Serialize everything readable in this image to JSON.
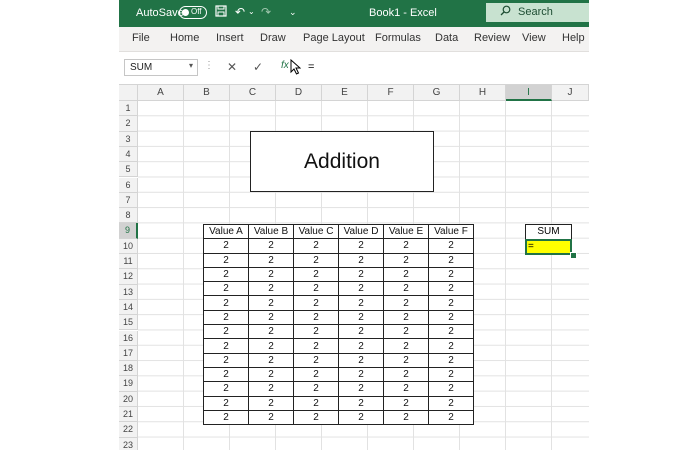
{
  "titlebar": {
    "autosave_label": "AutoSave",
    "autosave_state": "Off",
    "doc_title": "Book1  -  Excel",
    "search_placeholder": "Search",
    "accent": "#217346"
  },
  "menu": [
    "File",
    "Home",
    "Insert",
    "Draw",
    "Page Layout",
    "Formulas",
    "Data",
    "Review",
    "View",
    "Help"
  ],
  "formula_bar": {
    "name_box": "SUM",
    "formula": "="
  },
  "columns": [
    "A",
    "B",
    "C",
    "D",
    "E",
    "F",
    "G",
    "H",
    "I",
    "J"
  ],
  "selected_column": "I",
  "rows": [
    "1",
    "2",
    "3",
    "4",
    "5",
    "6",
    "7",
    "8",
    "9",
    "10",
    "11",
    "12",
    "13",
    "14",
    "15",
    "16",
    "17",
    "18",
    "19",
    "20",
    "21",
    "22",
    "23"
  ],
  "selected_row": "9",
  "sheet": {
    "title": "Addition",
    "table_headers": [
      "Value A",
      "Value B",
      "Value C",
      "Value D",
      "Value E",
      "Value F"
    ],
    "table_rows": [
      [
        "2",
        "2",
        "2",
        "2",
        "2",
        "2"
      ],
      [
        "2",
        "2",
        "2",
        "2",
        "2",
        "2"
      ],
      [
        "2",
        "2",
        "2",
        "2",
        "2",
        "2"
      ],
      [
        "2",
        "2",
        "2",
        "2",
        "2",
        "2"
      ],
      [
        "2",
        "2",
        "2",
        "2",
        "2",
        "2"
      ],
      [
        "2",
        "2",
        "2",
        "2",
        "2",
        "2"
      ],
      [
        "2",
        "2",
        "2",
        "2",
        "2",
        "2"
      ],
      [
        "2",
        "2",
        "2",
        "2",
        "2",
        "2"
      ],
      [
        "2",
        "2",
        "2",
        "2",
        "2",
        "2"
      ],
      [
        "2",
        "2",
        "2",
        "2",
        "2",
        "2"
      ],
      [
        "2",
        "2",
        "2",
        "2",
        "2",
        "2"
      ],
      [
        "2",
        "2",
        "2",
        "2",
        "2",
        "2"
      ],
      [
        "2",
        "2",
        "2",
        "2",
        "2",
        "2"
      ]
    ],
    "sum_header": "SUM",
    "sum_cell_value": "=",
    "sum_cell_color": "#ffff00"
  }
}
